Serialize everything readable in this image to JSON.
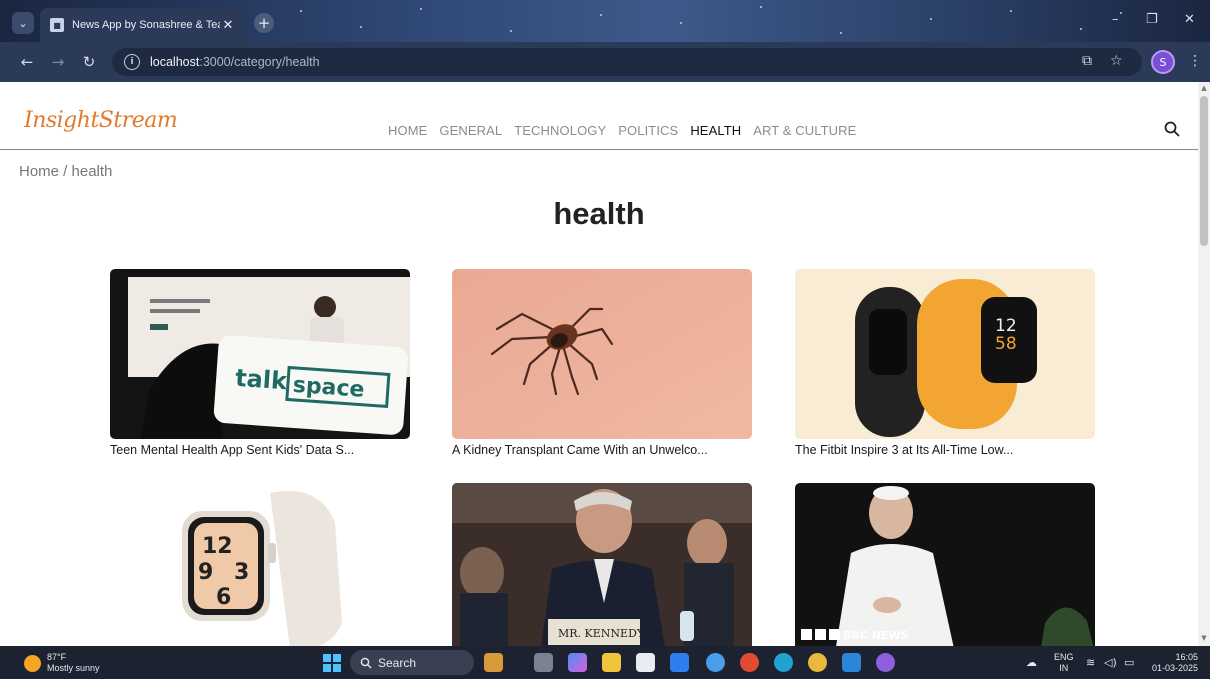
{
  "browser": {
    "tab_title": "News App by Sonashree & Team",
    "url_host": "localhost",
    "url_path": ":3000/category/health",
    "profile_initial": "S"
  },
  "site": {
    "logo": "InsightStream",
    "nav": [
      "HOME",
      "GENERAL",
      "TECHNOLOGY",
      "POLITICS",
      "HEALTH",
      "ART & CULTURE"
    ],
    "active_nav": "HEALTH"
  },
  "breadcrumb": "Home / health",
  "page_title": "health",
  "articles": [
    {
      "title": "Teen Mental Health App Sent Kids' Data S...",
      "image": "talkspace-phone-photo"
    },
    {
      "title": "A Kidney Transplant Came With an Unwelco...",
      "image": "tick-on-skin-photo"
    },
    {
      "title": "The Fitbit Inspire 3 at Its All-Time Low...",
      "image": "fitbit-bands-photo"
    },
    {
      "title": "",
      "image": "apple-watch-photo"
    },
    {
      "title": "",
      "image": "hearing-room-photo",
      "caption": "MR. KENNEDY"
    },
    {
      "title": "",
      "image": "pope-photo",
      "caption": "BBC NEWS"
    }
  ],
  "taskbar": {
    "temperature": "87°F",
    "weather": "Mostly sunny",
    "search_label": "Search",
    "lang_top": "ENG",
    "lang_bottom": "IN",
    "time": "16:05",
    "date": "01-03-2025"
  },
  "colors": {
    "logo": "#e07b2e",
    "nav_inactive": "#8c8c8c",
    "nav_active": "#111111"
  }
}
